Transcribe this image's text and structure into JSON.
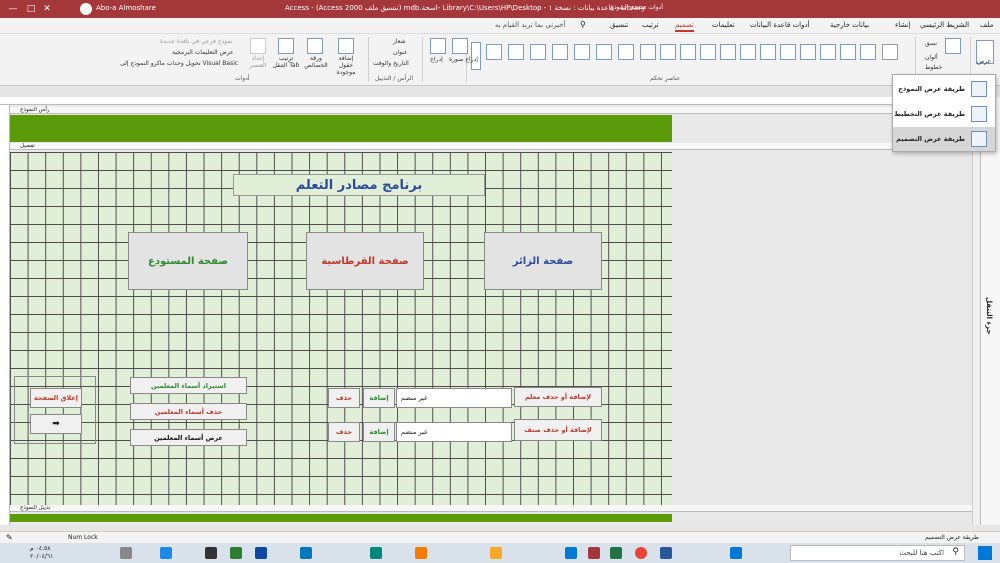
{
  "titlebar": {
    "user": "Abo-a Almoshare",
    "title": "Access  -  (Access 2000 تنسيق ملف) mdb.اسحة- Library\\C:\\Users\\HP\\Desktop - قاعدة بيانات : نسخة ١ - Library",
    "context_tab": "أدوات تصميم النموذج"
  },
  "menu": {
    "tabs": [
      "ملف",
      "الشريط الرئيسي",
      "إنشاء",
      "بيانات خارجية",
      "أدوات قاعدة البيانات",
      "تعليمات",
      "تصميم",
      "ترتيب",
      "تنسيق"
    ],
    "search_placeholder": "أخبرني بما تريد القيام به"
  },
  "ribbon": {
    "view_label": "عرض",
    "themes_items": [
      "نسق",
      "ألوان",
      "خطوط"
    ],
    "controls_group": "عناصر تحكم",
    "header_footer_group": "الرأس / التذييل",
    "header_items": [
      "شعار",
      "عنوان",
      "التاريخ والوقت"
    ],
    "insert_image": "إدراج صورة",
    "insert_label": "إدراج",
    "tools_group": "أدوات",
    "tools_buttons": [
      "إضافة حقول موجودة",
      "ورقة الخصائص",
      "ترتيب التنقل Tab",
      "إعداد العنصر"
    ],
    "tools_small": [
      "نموذج فرعي في نافذة جديدة",
      "عرض التعليمات البرمجية",
      "تحويل وحدات ماكرو النموذج إلى Visual Basic"
    ]
  },
  "view_menu": {
    "items": [
      "طريقة عرض النموذج",
      "طريقة عرض التخطيط",
      "طريقة عرض التصميم"
    ],
    "selected": 2
  },
  "form": {
    "header_band": "رأس النموذج",
    "detail_band": "تفصيل",
    "footer_band": "تذييل النموذج",
    "title": "برنامج مصادر التعلم",
    "big_buttons": [
      "صفحة الزائر",
      "صفحة القرطاسية",
      "صفحة المستودع"
    ],
    "teacher_label": "لإضافة أو حذف معلم",
    "class_label": "لإضافة أو حذف صنف",
    "combo_value": "غير منضم",
    "add": "إضافة",
    "delete": "حذف",
    "teachers_actions": [
      "استيراد أسماء المعلمين",
      "حذف أسماء المعلمين",
      "عرض أسماء المعلمين"
    ],
    "close_page": "إغلاق الصفحة"
  },
  "property_sheet": "جزء التنقل",
  "status": {
    "mode": "طريقة عرض التصميم",
    "numlock": "Num Lock"
  },
  "taskbar": {
    "search_placeholder": "اكتب هنا للبحث",
    "time": "٠٤:٥٨ م",
    "date": "٢٠/٠٤/٦١"
  }
}
